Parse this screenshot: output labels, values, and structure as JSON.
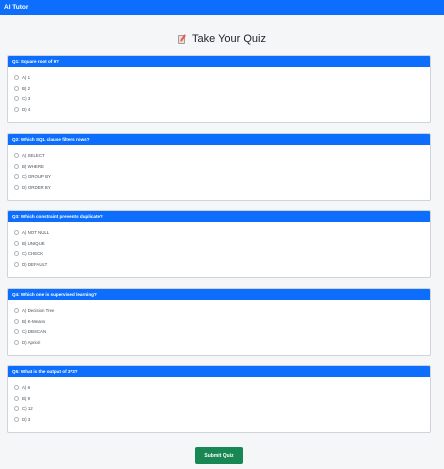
{
  "app": {
    "title": "AI Tutor"
  },
  "page": {
    "title": "Take Your Quiz",
    "title_icon": "memo-icon"
  },
  "questions": [
    {
      "label": "Q1: Square root of 9?",
      "options": [
        "A) 1",
        "B) 2",
        "C) 3",
        "D) 4"
      ]
    },
    {
      "label": "Q2: Which SQL clause filters rows?",
      "options": [
        "A) SELECT",
        "B) WHERE",
        "C) GROUP BY",
        "D) ORDER BY"
      ]
    },
    {
      "label": "Q3: Which constraint prevents duplicate?",
      "options": [
        "A) NOT NULL",
        "B) UNIQUE",
        "C) CHECK",
        "D) DEFAULT"
      ]
    },
    {
      "label": "Q4: Which one is supervised learning?",
      "options": [
        "A) Decision Tree",
        "B) K-Means",
        "C) DBSCAN",
        "D) Apriori"
      ]
    },
    {
      "label": "Q5: What is the output of 3*3?",
      "options": [
        "A) 6",
        "B) 9",
        "C) 12",
        "D) 3"
      ]
    }
  ],
  "submit_label": "Submit Quiz",
  "colors": {
    "primary": "#0d6efd",
    "success": "#198754",
    "background": "#f4f6f8"
  }
}
